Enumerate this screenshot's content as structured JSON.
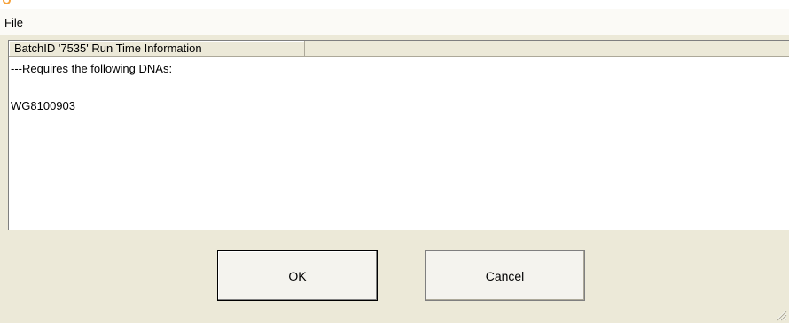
{
  "menubar": {
    "file_label": "File"
  },
  "panel": {
    "column_header": "BatchID '7535' Run Time Information",
    "lines": [
      "---Requires the following DNAs:",
      "",
      "WG8100903"
    ]
  },
  "buttons": {
    "ok_label": "OK",
    "cancel_label": "Cancel"
  },
  "colors": {
    "dialog_background": "#ece9d8",
    "app_icon_accent": "#f7a23b"
  }
}
